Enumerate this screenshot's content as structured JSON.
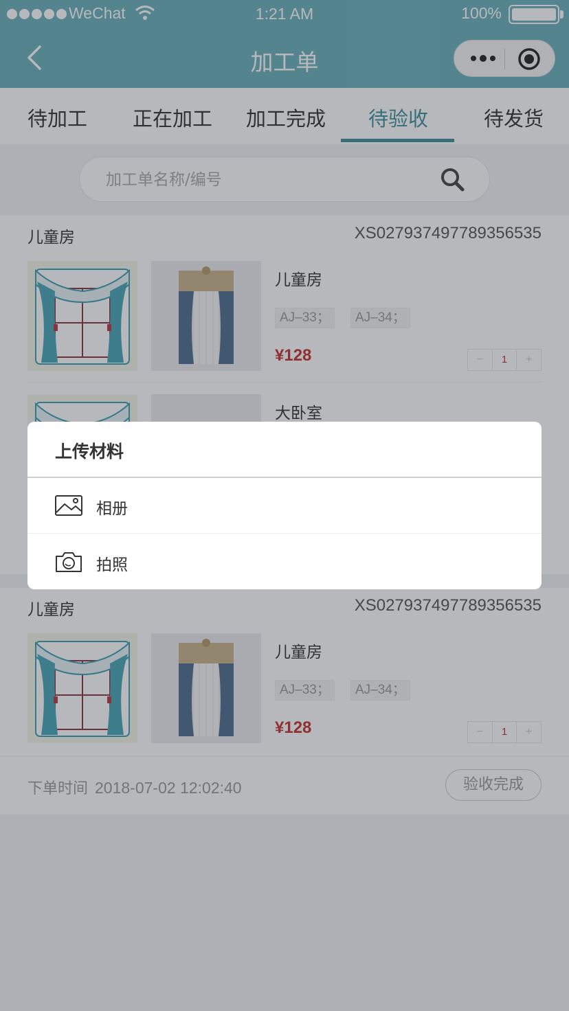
{
  "status_bar": {
    "carrier": "WeChat",
    "time": "1:21 AM",
    "battery": "100%"
  },
  "nav": {
    "title": "加工单"
  },
  "tabs": [
    {
      "label": "待加工"
    },
    {
      "label": "正在加工"
    },
    {
      "label": "加工完成"
    },
    {
      "label": "待验收"
    },
    {
      "label": "待发货"
    }
  ],
  "active_tab_index": 3,
  "search": {
    "placeholder": "加工单名称/编号"
  },
  "orders": [
    {
      "room": "儿童房",
      "code": "XS027937497789356535",
      "items": [
        {
          "name": "儿童房",
          "tags": [
            "AJ–33；",
            "AJ–34；"
          ],
          "price": "¥128",
          "qty": "1",
          "minus": "−",
          "plus": "+"
        },
        {
          "name": "大卧室"
        }
      ]
    },
    {
      "room": "儿童房",
      "code": "XS027937497789356535",
      "items": [
        {
          "name": "儿童房",
          "tags": [
            "AJ–33；",
            "AJ–34；"
          ],
          "price": "¥128",
          "qty": "1",
          "minus": "−",
          "plus": "+"
        }
      ],
      "footer": {
        "time_label": "下单时间",
        "time": "2018-07-02 12:02:40",
        "button": "验收完成"
      }
    }
  ],
  "action_sheet": {
    "title": "上传材料",
    "options": [
      {
        "label": "相册",
        "icon": "image-icon"
      },
      {
        "label": "拍照",
        "icon": "camera-icon"
      }
    ]
  },
  "colors": {
    "header": "#6bb2bd",
    "accent": "#3d8f9c",
    "price": "#c4332f"
  }
}
